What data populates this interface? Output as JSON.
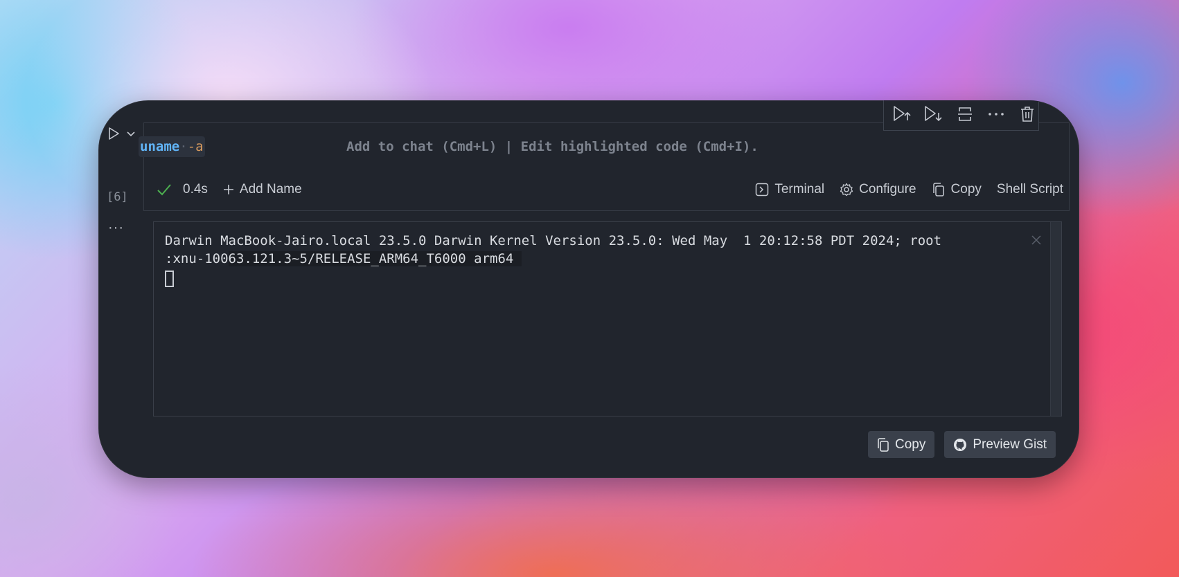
{
  "cell": {
    "execution_count": "[6]",
    "code_command": "uname",
    "code_flag": "-a",
    "hint": "Add to chat (Cmd+L) | Edit highlighted code (Cmd+I).",
    "duration": "0.4s",
    "add_name_label": "Add Name",
    "actions": {
      "terminal": "Terminal",
      "configure": "Configure",
      "copy": "Copy",
      "language": "Shell Script"
    },
    "toolbar_icons": [
      "run-above-icon",
      "run-below-icon",
      "split-cell-icon",
      "more-icon",
      "trash-icon"
    ]
  },
  "output": {
    "line1": "Darwin MacBook-Jairo.local 23.5.0 Darwin Kernel Version 23.5.0: Wed May  1 20:12:58 PDT 2024; root",
    "line2_prefix": ":xnu-100",
    "line2_selected": "63.121.3~5/RELEASE_ARM64_T6000 arm64 "
  },
  "buttons": {
    "copy": "Copy",
    "preview_gist": "Preview Gist"
  },
  "colors": {
    "panel": "#21252d",
    "accent_command": "#61b4f7",
    "accent_flag": "#d79a5e",
    "success": "#4caf50"
  }
}
